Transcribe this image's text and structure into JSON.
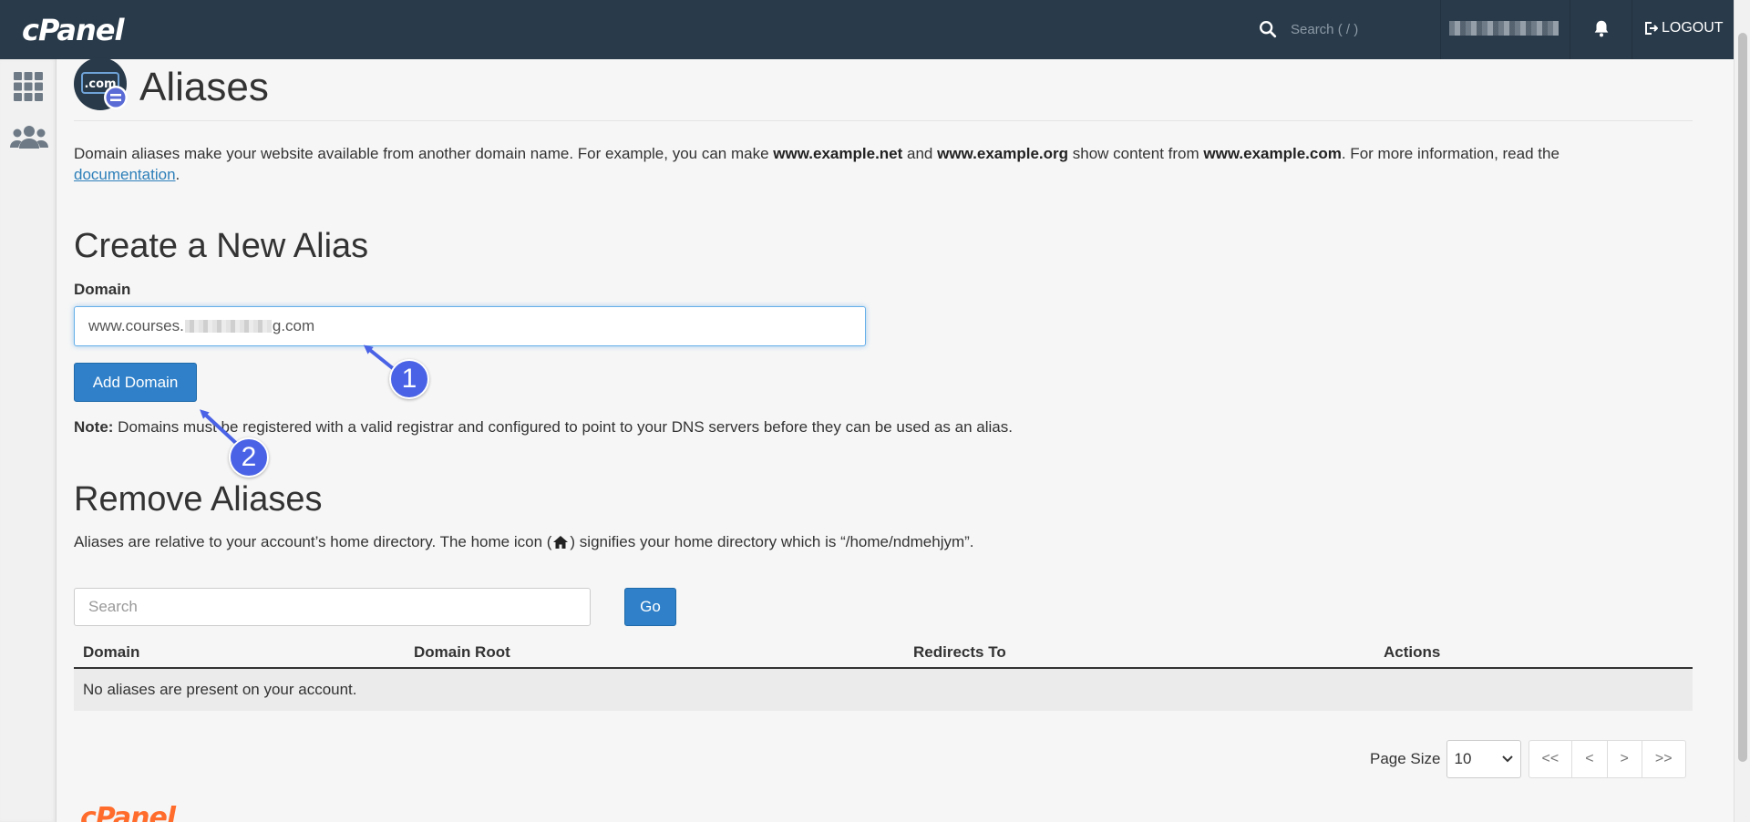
{
  "topbar": {
    "logo": "cPanel",
    "search_placeholder": "Search ( / )",
    "logout_label": "LOGOUT"
  },
  "sidebar": {
    "items": [
      {
        "icon": "grid-icon"
      },
      {
        "icon": "users-icon"
      }
    ]
  },
  "page": {
    "title": "Aliases",
    "feature_icon_text": ".com",
    "intro": {
      "part1": "Domain aliases make your website available from another domain name. For example, you can make ",
      "ex1": "www.example.net",
      "part2": " and ",
      "ex2": "www.example.org",
      "part3": " show content from ",
      "ex3": "www.example.com",
      "part4": ". For more information, read the ",
      "link": "documentation",
      "end": "."
    }
  },
  "create": {
    "heading": "Create a New Alias",
    "domain_label": "Domain",
    "domain_value_prefix": "www.courses.",
    "domain_value_suffix": "g.com",
    "add_button": "Add Domain",
    "note_label": "Note:",
    "note_text": " Domains must be registered with a valid registrar and configured to point to your DNS servers before they can be used as an alias."
  },
  "remove": {
    "heading": "Remove Aliases",
    "desc_before": "Aliases are relative to your account’s home directory. The home icon (",
    "desc_after": ") signifies your home directory which is “/home/ndmehjym”.",
    "search_placeholder": "Search",
    "go_button": "Go",
    "columns": [
      "Domain",
      "Domain Root",
      "Redirects To",
      "Actions"
    ],
    "empty_message": "No aliases are present on your account."
  },
  "pagination": {
    "page_size_label": "Page Size",
    "page_size_value": "10",
    "buttons": [
      "<<",
      "<",
      ">",
      ">>"
    ]
  },
  "annotations": [
    "1",
    "2"
  ],
  "footer": {
    "logo": "cPanel"
  },
  "colors": {
    "topbar": "#293a4a",
    "primary_button": "#2f80c9",
    "annotation": "#4a63e6",
    "link": "#2d7fb9",
    "footer_logo": "#ff6c2c"
  }
}
